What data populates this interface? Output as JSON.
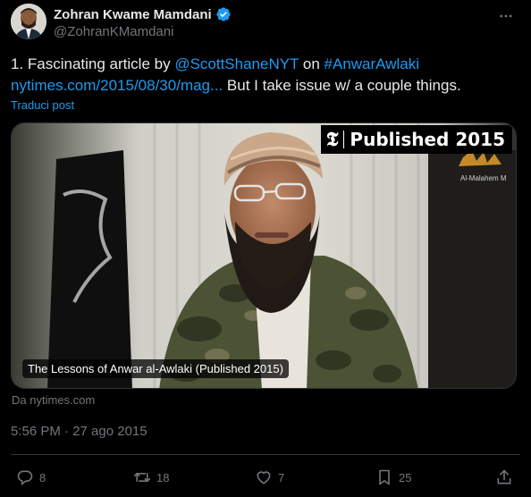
{
  "author": {
    "name": "Zohran Kwame Mamdani",
    "handle": "@ZohranKMamdani"
  },
  "tweet": {
    "prefix": "1. Fascinating article by ",
    "mention": "@ScottShaneNYT",
    "middle": " on ",
    "hashtag": "#AnwarAwlaki",
    "url": "nytimes.com/2015/08/30/mag...",
    "suffix": " But I take issue w/ a couple things."
  },
  "translate_label": "Traduci post",
  "card": {
    "badge_logo": "𝕿",
    "badge_text": "Published 2015",
    "title": "The Lessons of Anwar al-Awlaki (Published 2015)",
    "overlay_text": "Al-Malahem M"
  },
  "source_label": "Da nytimes.com",
  "timestamp": "5:56 PM · 27 ago 2015",
  "actions": {
    "replies": "8",
    "reposts": "18",
    "likes": "7",
    "bookmarks": "25"
  },
  "colors": {
    "accent": "#1d9bf0",
    "muted": "#71767b",
    "text": "#e7e9ea",
    "background": "#000000"
  }
}
